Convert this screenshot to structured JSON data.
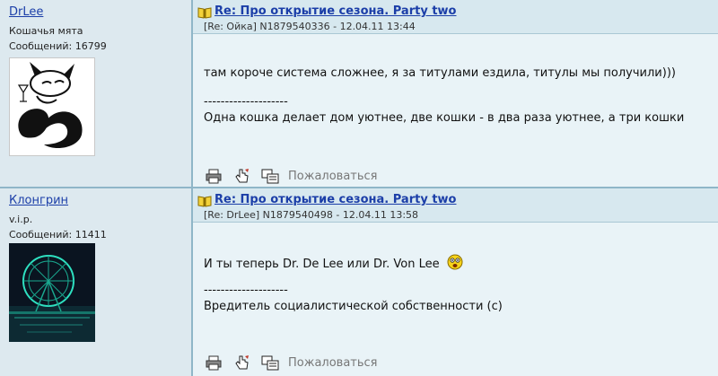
{
  "posts": [
    {
      "author": "DrLee",
      "status": "Кошачья мята",
      "count_text": "Сообщений: 16799",
      "title": "Re: Про открытие сезона. Party two",
      "meta": "[Re: Ойка]  N1879540336 - 12.04.11 13:44",
      "line1": "там короче система сложнее, я за титулами ездила, титулы мы получили)))",
      "sig_divider": "--------------------",
      "sig_text": "Одна кошка делает дом уютнее, две кошки - в два раза уютнее, а три кошки",
      "report": "Пожаловаться"
    },
    {
      "author": "Клонгрин",
      "status": "v.i.p.",
      "count_text": "Сообщений: 11411",
      "title": "Re: Про открытие сезона. Party two",
      "meta": "[Re: DrLee]  N1879540498 - 12.04.11 13:58",
      "line1": "И ты теперь Dr. De Lee или Dr. Von Lee",
      "sig_divider": "--------------------",
      "sig_text": "Вредитель социалистической собственности (с)",
      "report": "Пожаловаться"
    }
  ],
  "icons": [
    "book-icon",
    "print-icon",
    "quote-hand-icon",
    "reply-icon",
    "smiley-icon",
    "cat-avatar",
    "ferris-wheel-avatar"
  ]
}
